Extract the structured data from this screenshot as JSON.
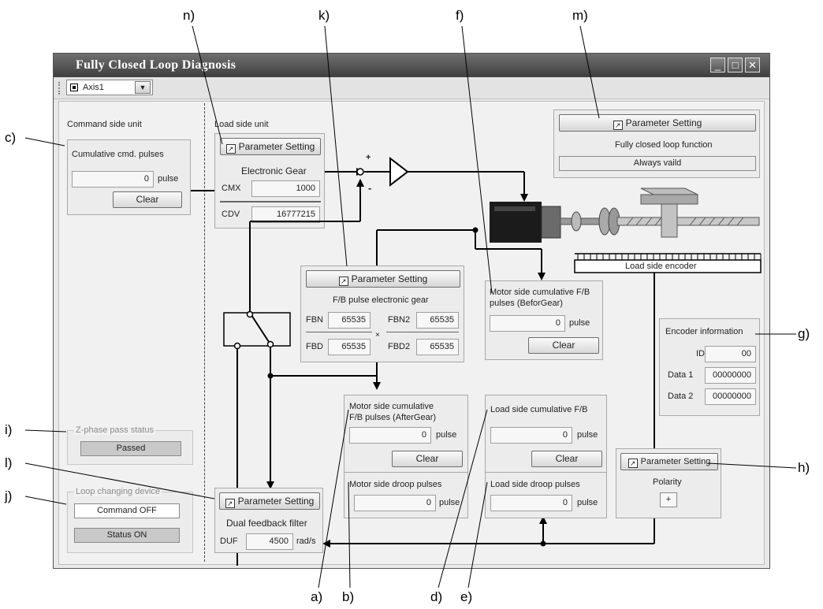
{
  "callouts": {
    "a": "a)",
    "b": "b)",
    "c": "c)",
    "d": "d)",
    "e": "e)",
    "f": "f)",
    "g": "g)",
    "h": "h)",
    "i": "i)",
    "j": "j)",
    "k": "k)",
    "l": "l)",
    "m": "m)",
    "n": "n)"
  },
  "window": {
    "title": "Fully Closed Loop Diagnosis",
    "minimize": "_",
    "maximize": "□",
    "close": "✕"
  },
  "toolbar": {
    "axis": "Axis1"
  },
  "command_side": {
    "header": "Command side unit",
    "cum_cmd_label": "Cumulative cmd. pulses",
    "cum_cmd_value": "0",
    "unit_pulse": "pulse",
    "clear": "Clear"
  },
  "load_side": {
    "header": "Load side unit",
    "param_setting": "Parameter Setting",
    "electronic_gear": "Electronic Gear",
    "cmx_label": "CMX",
    "cmx_value": "1000",
    "cdv_label": "CDV",
    "cdv_value": "16777215"
  },
  "diagram": {
    "plus": "+",
    "minus": "-"
  },
  "fb_gear": {
    "param_setting": "Parameter Setting",
    "title": "F/B pulse electronic gear",
    "fbn_label": "FBN",
    "fbn_value": "65535",
    "fbn2_label": "FBN2",
    "fbn2_value": "65535",
    "fbd_label": "FBD",
    "fbd_value": "65535",
    "fbd2_label": "FBD2",
    "fbd2_value": "65535",
    "times": "×"
  },
  "motor_before": {
    "line1": "Motor side cumulative F/B",
    "line2": "pulses (BeforGear)",
    "value": "0",
    "unit": "pulse",
    "clear": "Clear"
  },
  "top_right": {
    "param_setting": "Parameter Setting",
    "function_label": "Fully closed loop function",
    "function_value": "Always vaild"
  },
  "encoder_label": "Load side encoder",
  "encoder_info": {
    "title": "Encoder information",
    "id_label": "ID",
    "id_value": "00",
    "data1_label": "Data 1",
    "data1_value": "00000000",
    "data2_label": "Data 2",
    "data2_value": "00000000"
  },
  "motor_after": {
    "line1": "Motor side cumulative",
    "line2": "F/B pulses (AfterGear)",
    "value": "0",
    "unit": "pulse",
    "clear": "Clear",
    "droop_label": "Motor side droop pulses",
    "droop_value": "0",
    "droop_unit": "pulse"
  },
  "load_cum": {
    "label": "Load side cumulative F/B",
    "value": "0",
    "unit": "pulse",
    "clear": "Clear",
    "droop_label": "Load side droop pulses",
    "droop_value": "0",
    "droop_unit": "pulse"
  },
  "polarity": {
    "param_setting": "Parameter Setting",
    "label": "Polarity",
    "value": "+"
  },
  "zphase": {
    "title": "Z-phase pass status",
    "value": "Passed"
  },
  "loop_device": {
    "title": "Loop changing device",
    "command": "Command OFF",
    "status": "Status ON"
  },
  "dual_filter": {
    "param_setting": "Parameter Setting",
    "title": "Dual feedback filter",
    "duf_label": "DUF",
    "duf_value": "4500",
    "unit": "rad/s"
  }
}
